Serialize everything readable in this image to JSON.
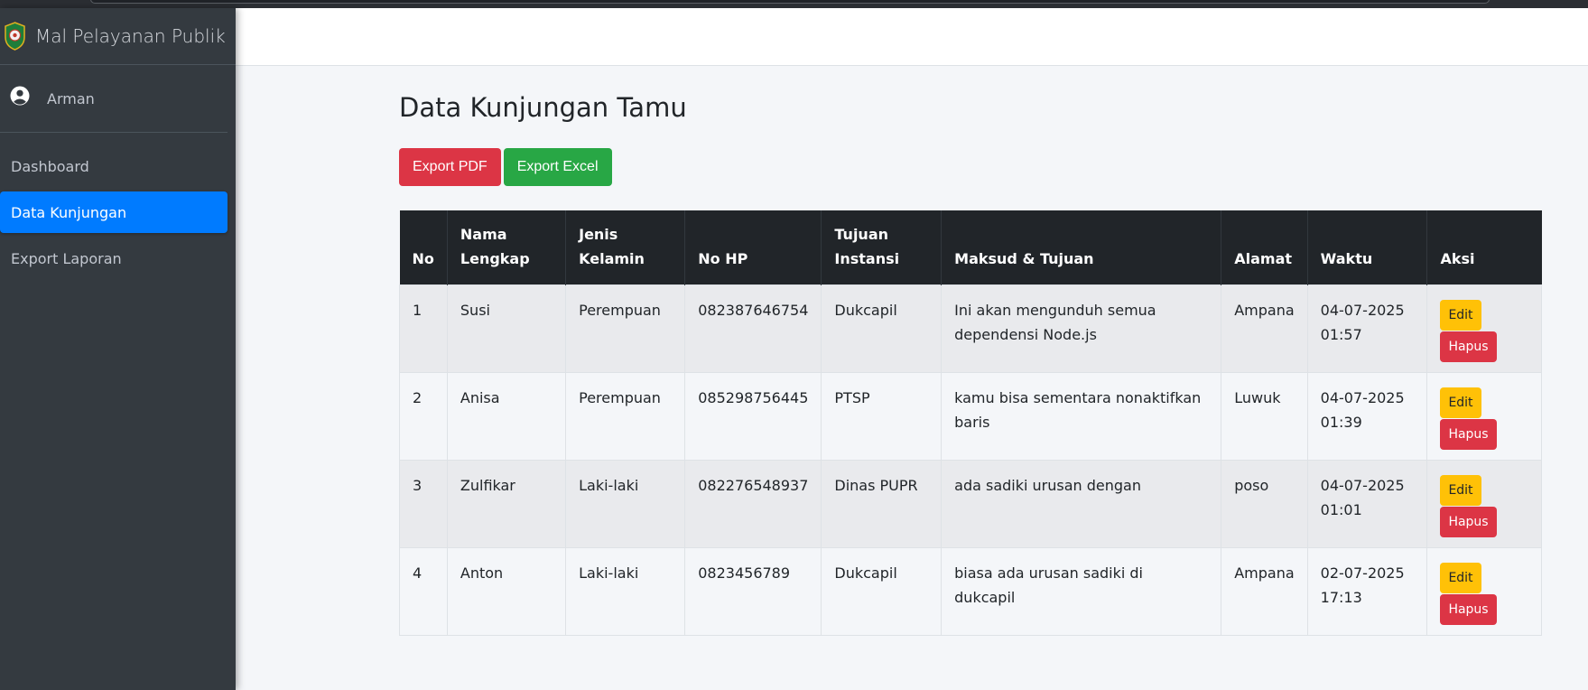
{
  "app": {
    "title": "Mal Pelayanan Publik"
  },
  "user": {
    "name": "Arman"
  },
  "sidebar": {
    "items": [
      {
        "label": "Dashboard",
        "active": false
      },
      {
        "label": "Data Kunjungan",
        "active": true
      },
      {
        "label": "Export Laporan",
        "active": false
      }
    ]
  },
  "page": {
    "title": "Data Kunjungan Tamu",
    "export_pdf_label": "Export PDF",
    "export_excel_label": "Export Excel"
  },
  "table": {
    "headers": {
      "no": "No",
      "nama_1": "Nama",
      "nama_2": "Lengkap",
      "jk_1": "Jenis",
      "jk_2": "Kelamin",
      "hp": "No HP",
      "ti_1": "Tujuan",
      "ti_2": "Instansi",
      "maksud": "Maksud & Tujuan",
      "alamat": "Alamat",
      "waktu": "Waktu",
      "aksi": "Aksi"
    },
    "rows": [
      {
        "no": "1",
        "nama": "Susi",
        "jk": "Perempuan",
        "hp": "082387646754",
        "instansi": "Dukcapil",
        "maksud_1": "Ini akan mengunduh semua",
        "maksud_2": "dependensi Node.js",
        "alamat": "Ampana",
        "tanggal": "04-07-2025",
        "jam": "01:57",
        "edit": "Edit",
        "hapus": "Hapus"
      },
      {
        "no": "2",
        "nama": "Anisa",
        "jk": "Perempuan",
        "hp": "085298756445",
        "instansi": "PTSP",
        "maksud_1": "kamu bisa sementara nonaktifkan baris",
        "maksud_2": "",
        "alamat": "Luwuk",
        "tanggal": "04-07-2025",
        "jam": "01:39",
        "edit": "Edit",
        "hapus": "Hapus"
      },
      {
        "no": "3",
        "nama": "Zulfikar",
        "jk": "Laki-laki",
        "hp": "082276548937",
        "instansi": "Dinas PUPR",
        "maksud_1": "ada sadiki urusan dengan",
        "maksud_2": "",
        "alamat": "poso",
        "tanggal": "04-07-2025",
        "jam": "01:01",
        "edit": "Edit",
        "hapus": "Hapus"
      },
      {
        "no": "4",
        "nama": "Anton",
        "jk": "Laki-laki",
        "hp": "0823456789",
        "instansi": "Dukcapil",
        "maksud_1": "biasa ada urusan sadiki di dukcapil",
        "maksud_2": "",
        "alamat": "Ampana",
        "tanggal": "02-07-2025",
        "jam": "17:13",
        "edit": "Edit",
        "hapus": "Hapus"
      }
    ]
  },
  "colors": {
    "sidebar_bg": "#343a40",
    "active_nav": "#007bff",
    "danger": "#dc3545",
    "success": "#28a745",
    "warning": "#ffc107",
    "table_head": "#212529"
  }
}
